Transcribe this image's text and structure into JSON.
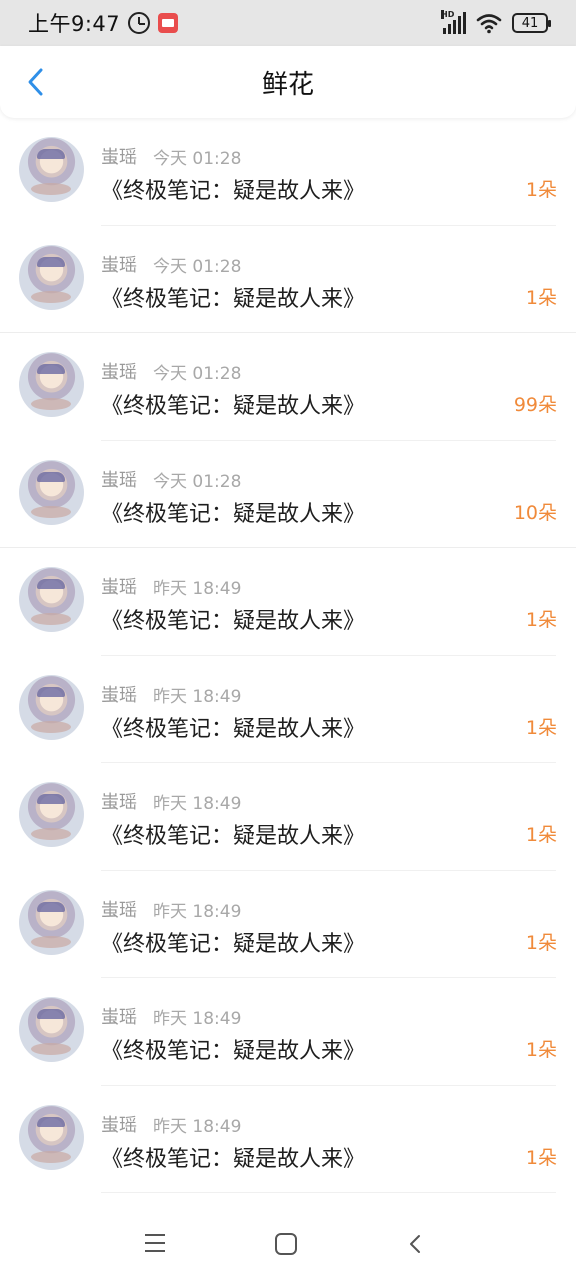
{
  "status_bar": {
    "time": "上午9:47",
    "signal_tag": "HD",
    "battery": "41"
  },
  "header": {
    "title": "鲜花"
  },
  "items": [
    {
      "name": "蚩瑶",
      "time": "今天 01:28",
      "title": "《终极笔记：疑是故人来》",
      "count": "1朵"
    },
    {
      "name": "蚩瑶",
      "time": "今天 01:28",
      "title": "《终极笔记：疑是故人来》",
      "count": "1朵"
    },
    {
      "name": "蚩瑶",
      "time": "今天 01:28",
      "title": "《终极笔记：疑是故人来》",
      "count": "99朵"
    },
    {
      "name": "蚩瑶",
      "time": "今天 01:28",
      "title": "《终极笔记：疑是故人来》",
      "count": "10朵"
    },
    {
      "name": "蚩瑶",
      "time": "昨天 18:49",
      "title": "《终极笔记：疑是故人来》",
      "count": "1朵"
    },
    {
      "name": "蚩瑶",
      "time": "昨天 18:49",
      "title": "《终极笔记：疑是故人来》",
      "count": "1朵"
    },
    {
      "name": "蚩瑶",
      "time": "昨天 18:49",
      "title": "《终极笔记：疑是故人来》",
      "count": "1朵"
    },
    {
      "name": "蚩瑶",
      "time": "昨天 18:49",
      "title": "《终极笔记：疑是故人来》",
      "count": "1朵"
    },
    {
      "name": "蚩瑶",
      "time": "昨天 18:49",
      "title": "《终极笔记：疑是故人来》",
      "count": "1朵"
    },
    {
      "name": "蚩瑶",
      "time": "昨天 18:49",
      "title": "《终极笔记：疑是故人来》",
      "count": "1朵"
    }
  ],
  "colors": {
    "accent_blue": "#2f8fe8",
    "count_orange": "#f08a3a",
    "meta_gray": "#9a9a9a"
  },
  "icons": {
    "back": "chevron-left-icon",
    "alarm": "alarm-clock-icon",
    "wifi": "wifi-icon",
    "signal": "signal-bars-icon",
    "battery": "battery-icon",
    "nav_menu": "menu-lines-icon",
    "nav_home": "home-square-icon",
    "nav_back": "back-chevron-icon"
  }
}
